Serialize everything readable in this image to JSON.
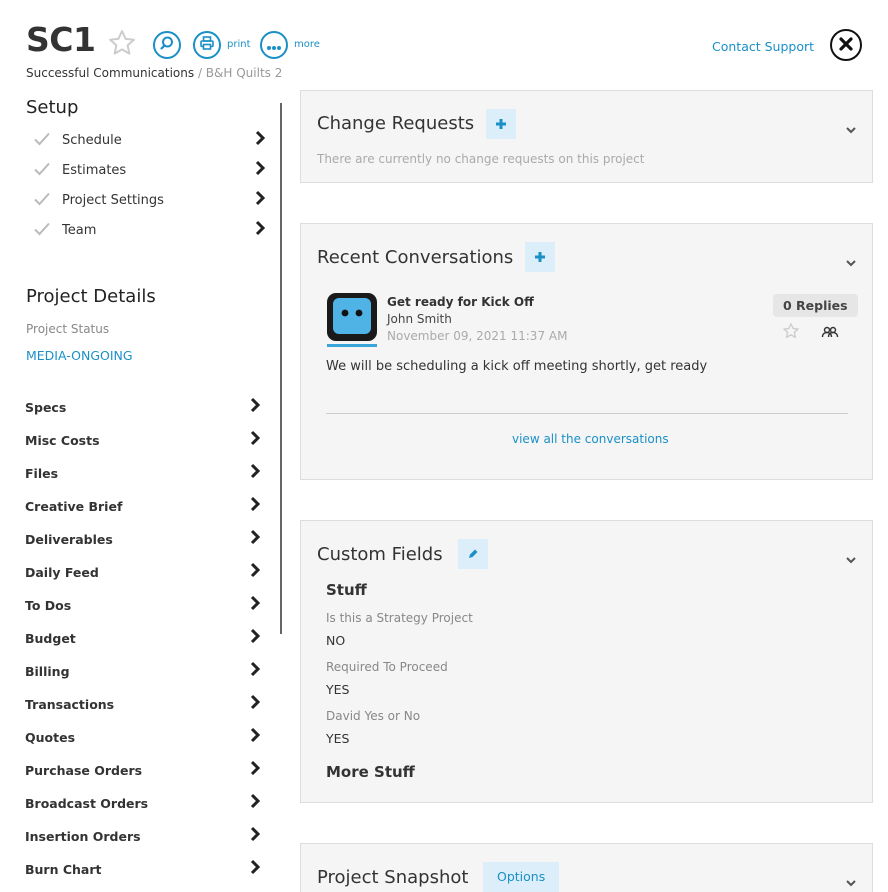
{
  "header": {
    "title": "SC1",
    "print_label": "print",
    "more_label": "more",
    "breadcrumb_client": "Successful Communications",
    "breadcrumb_sep": " / ",
    "breadcrumb_project": "B&H Quilts 2",
    "contact_support": "Contact Support"
  },
  "setup": {
    "heading": "Setup",
    "items": [
      {
        "label": "Schedule"
      },
      {
        "label": "Estimates"
      },
      {
        "label": "Project Settings"
      },
      {
        "label": "Team"
      }
    ]
  },
  "details": {
    "heading": "Project Details",
    "status_label": "Project Status",
    "status_value": "MEDIA-ONGOING"
  },
  "nav": {
    "items": [
      {
        "label": "Specs"
      },
      {
        "label": "Misc Costs"
      },
      {
        "label": "Files"
      },
      {
        "label": "Creative Brief"
      },
      {
        "label": "Deliverables"
      },
      {
        "label": "Daily Feed"
      },
      {
        "label": "To Dos"
      },
      {
        "label": "Budget"
      },
      {
        "label": "Billing"
      },
      {
        "label": "Transactions"
      },
      {
        "label": "Quotes"
      },
      {
        "label": "Purchase Orders"
      },
      {
        "label": "Broadcast Orders"
      },
      {
        "label": "Insertion Orders"
      },
      {
        "label": "Burn Chart"
      }
    ]
  },
  "change_requests": {
    "title": "Change Requests",
    "empty": "There are currently no change requests on this project"
  },
  "conversations": {
    "title": "Recent Conversations",
    "item": {
      "subject": "Get ready for Kick Off",
      "author": "John Smith",
      "date": "November 09, 2021 11:37 AM",
      "replies": "0 Replies",
      "body": "We will be scheduling a kick off meeting shortly, get ready"
    },
    "view_all": "view all the conversations"
  },
  "custom_fields": {
    "title": "Custom Fields",
    "group1": "Stuff",
    "fields": [
      {
        "label": "Is this a Strategy Project",
        "value": "NO"
      },
      {
        "label": "Required To Proceed",
        "value": "YES"
      },
      {
        "label": "David Yes or No",
        "value": "YES"
      }
    ],
    "group2": "More Stuff"
  },
  "snapshot": {
    "title": "Project Snapshot",
    "options_label": "Options"
  },
  "colors": {
    "accent": "#1a90c6",
    "panel_bg": "#f5f5f5",
    "button_bg": "#dceefa"
  }
}
